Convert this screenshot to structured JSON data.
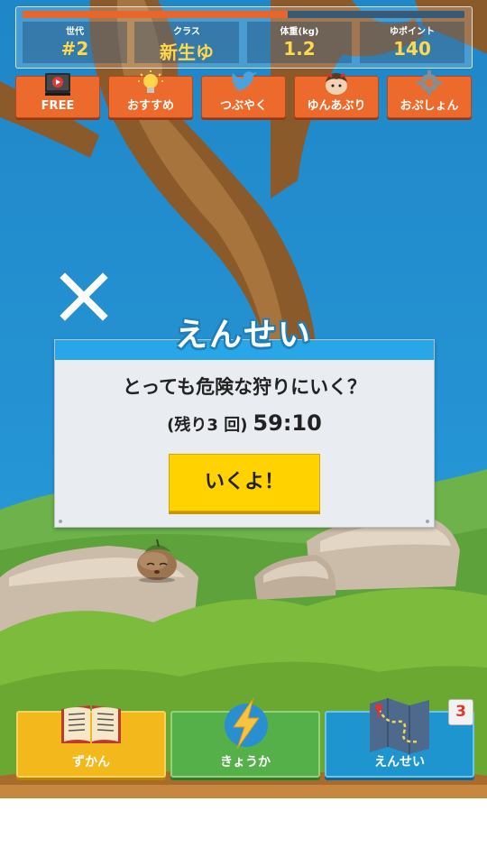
{
  "status": {
    "exp_progress": 0.6,
    "stats": [
      {
        "label": "世代",
        "value": "#2"
      },
      {
        "label": "クラス",
        "value": "新生ゆ"
      },
      {
        "label": "体重(kg)",
        "value": "1.2"
      },
      {
        "label": "ゆポイント",
        "value": "140"
      }
    ]
  },
  "menu": {
    "free": "FREE",
    "recommend": "おすすめ",
    "tweet": "つぶやく",
    "yun_aburi": "ゆんあぶり",
    "options": "おぷしょん"
  },
  "dialog": {
    "title": "えんせい",
    "question": "とっても危険な狩りにいく？",
    "remaining_label": "(残り3 回)",
    "timer": "59:10",
    "go_button": "いくよ！"
  },
  "bottom": {
    "zukan": "ずかん",
    "kyouka": "きょうか",
    "ensei": "えんせい",
    "ensei_badge": "3"
  },
  "colors": {
    "accent_orange": "#ec6a2b",
    "dialog_blue": "#29a6e8",
    "go_yellow": "#ffd200",
    "sky": "#1e8ccd"
  }
}
